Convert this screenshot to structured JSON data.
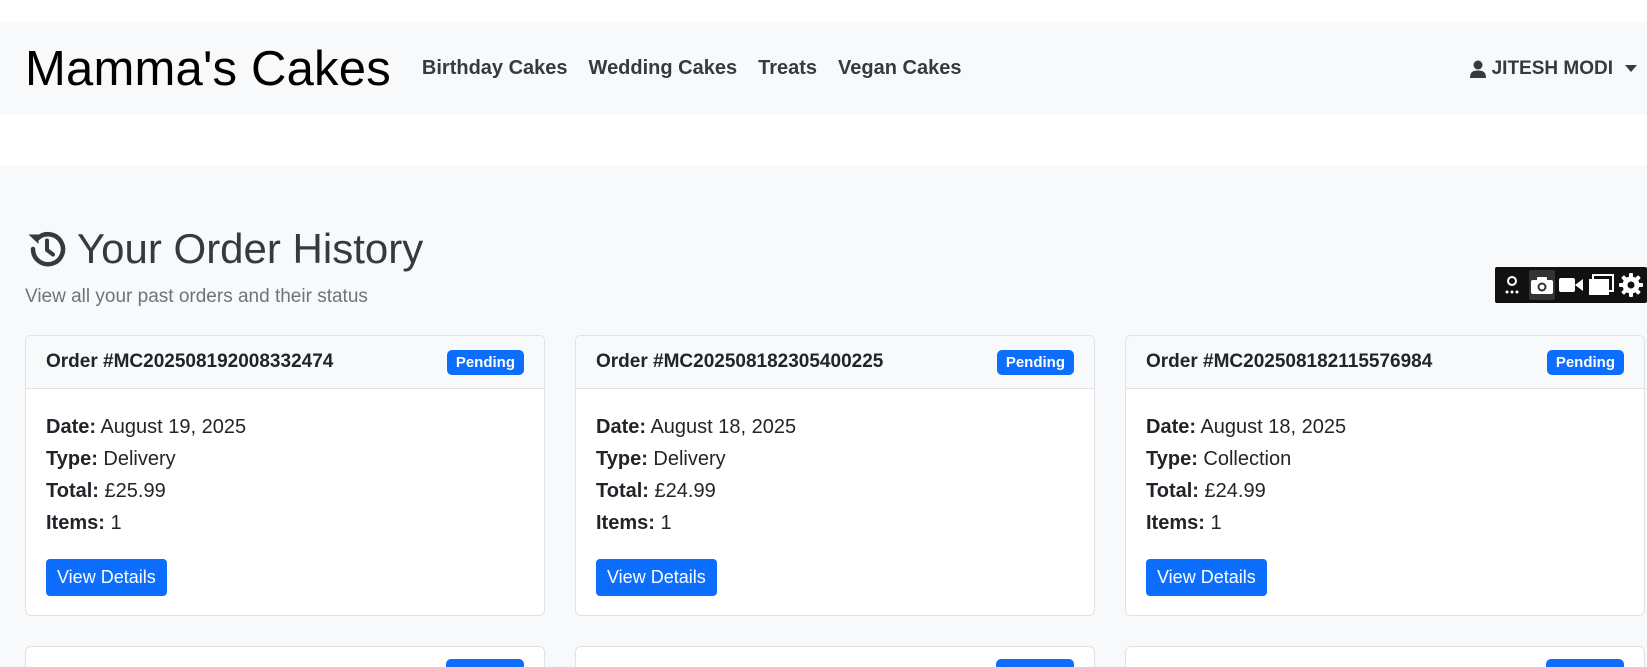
{
  "nav": {
    "brand": "Mamma's Cakes",
    "links": [
      "Birthday Cakes",
      "Wedding Cakes",
      "Treats",
      "Vegan Cakes"
    ],
    "user": "JITESH MODI"
  },
  "page": {
    "title": "Your Order History",
    "subtitle": "View all your past orders and their status"
  },
  "labels": {
    "date": "Date:",
    "type": "Type:",
    "total": "Total:",
    "items": "Items:",
    "view": "View Details"
  },
  "orders": [
    {
      "number": "Order #MC202508192008332474",
      "status": "Pending",
      "date": "August 19, 2025",
      "type": "Delivery",
      "total": "£25.99",
      "items": "1"
    },
    {
      "number": "Order #MC202508182305400225",
      "status": "Pending",
      "date": "August 18, 2025",
      "type": "Delivery",
      "total": "£24.99",
      "items": "1"
    },
    {
      "number": "Order #MC202508182115576984",
      "status": "Pending",
      "date": "August 18, 2025",
      "type": "Collection",
      "total": "£24.99",
      "items": "1"
    }
  ],
  "icons": {
    "user": "user-icon",
    "history": "history-icon",
    "toolbar": [
      "pin-icon",
      "camera-icon",
      "video-icon",
      "window-icon",
      "gear-icon"
    ]
  },
  "colors": {
    "primary": "#0d6efd",
    "navbar_bg": "#f8f9fa",
    "toolbar_bg": "#111111"
  }
}
